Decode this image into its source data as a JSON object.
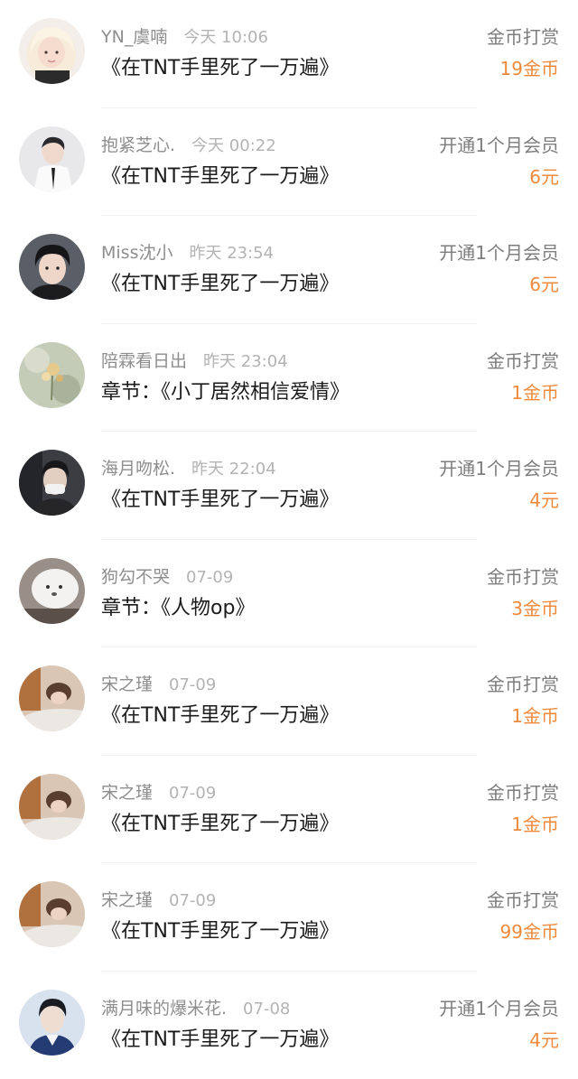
{
  "accent_color": "#ef8a3c",
  "records": [
    {
      "name": "YN_虞喃",
      "time": "今天 10:06",
      "title": "《在TNT手里死了一万遍》",
      "type": "金币打赏",
      "amount": "19金币",
      "avatar": "avatar-blonde-girl"
    },
    {
      "name": "抱紧芝心.",
      "time": "今天 00:22",
      "title": "《在TNT手里死了一万遍》",
      "type": "开通1个月会员",
      "amount": "6元",
      "avatar": "avatar-boy-white-shirt"
    },
    {
      "name": "Miss沈小",
      "time": "昨天 23:54",
      "title": "《在TNT手里死了一万遍》",
      "type": "开通1个月会员",
      "amount": "6元",
      "avatar": "avatar-boy-dark-hair"
    },
    {
      "name": "陪霖看日出",
      "time": "昨天 23:04",
      "title": "章节：《小丁居然相信爱情》",
      "type": "金币打赏",
      "amount": "1金币",
      "avatar": "avatar-flowers"
    },
    {
      "name": "海月吻松.",
      "time": "昨天 22:04",
      "title": "《在TNT手里死了一万遍》",
      "type": "开通1个月会员",
      "amount": "4元",
      "avatar": "avatar-boy-mask"
    },
    {
      "name": "狗勾不哭",
      "time": "07-09",
      "title": "章节：《人物op》",
      "type": "金币打赏",
      "amount": "3金币",
      "avatar": "avatar-white-dog"
    },
    {
      "name": "宋之瑾",
      "time": "07-09",
      "title": "《在TNT手里死了一万遍》",
      "type": "金币打赏",
      "amount": "1金币",
      "avatar": "avatar-girl-lying"
    },
    {
      "name": "宋之瑾",
      "time": "07-09",
      "title": "《在TNT手里死了一万遍》",
      "type": "金币打赏",
      "amount": "1金币",
      "avatar": "avatar-girl-lying"
    },
    {
      "name": "宋之瑾",
      "time": "07-09",
      "title": "《在TNT手里死了一万遍》",
      "type": "金币打赏",
      "amount": "99金币",
      "avatar": "avatar-girl-lying"
    },
    {
      "name": "满月味的爆米花.",
      "time": "07-08",
      "title": "《在TNT手里死了一万遍》",
      "type": "开通1个月会员",
      "amount": "4元",
      "avatar": "avatar-boy-blue-jacket"
    }
  ]
}
